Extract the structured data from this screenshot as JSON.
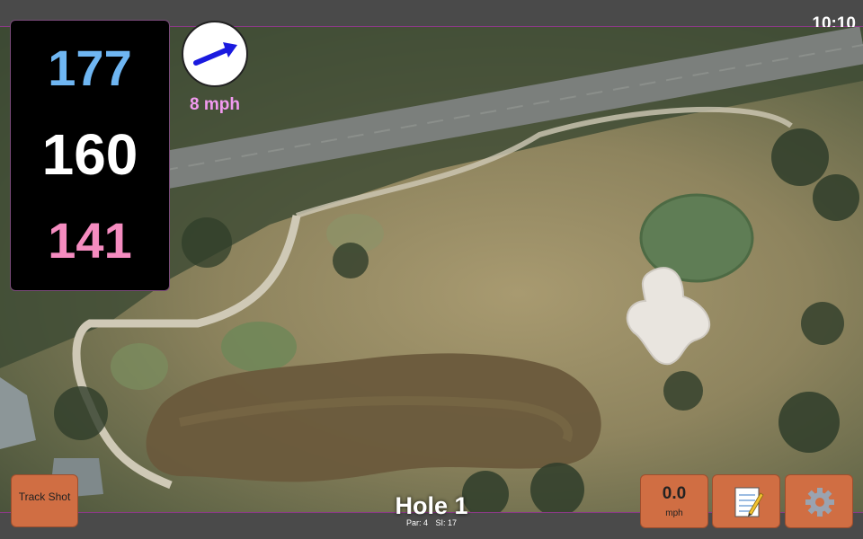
{
  "status": {
    "time": "10:10"
  },
  "distances": {
    "back": "177",
    "middle": "160",
    "front": "141",
    "colors": {
      "back": "#6fb6f2",
      "middle": "#ffffff",
      "front": "#f58cc0"
    }
  },
  "wind": {
    "speed": "8 mph",
    "color": "#f29af0",
    "icon": "wind-direction-arrow"
  },
  "hole": {
    "title": "Hole 1",
    "par": "Par: 4",
    "si": "SI: 17"
  },
  "buttons": {
    "track_shot": "Track Shot",
    "speed_value": "0.0",
    "speed_unit": "mph",
    "notes_icon": "notepad-icon",
    "settings_icon": "gear-icon"
  },
  "theme": {
    "accent": "#d06e43",
    "bar": "#4a4a4a",
    "border": "#8a3a86"
  }
}
